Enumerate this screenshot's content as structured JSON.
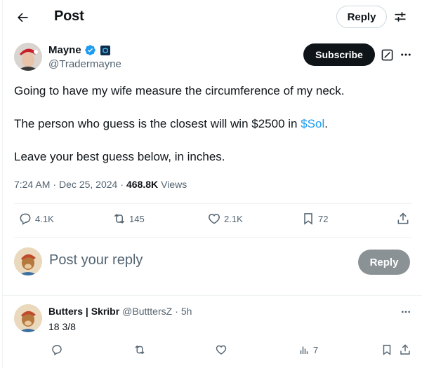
{
  "header": {
    "title": "Post",
    "reply_label": "Reply",
    "back_icon": "arrow-left-icon",
    "filter_icon": "sliders-icon"
  },
  "author": {
    "name": "Mayne",
    "handle": "@Tradermayne",
    "verified": true,
    "subscribe_label": "Subscribe"
  },
  "tweet": {
    "line1": "Going to have my wife measure the circumference of my neck.",
    "line2_before": "The person who guess is the closest will win $2500 in ",
    "line2_cashtag": "$Sol",
    "line2_after": ".",
    "line3": "Leave your best guess below, in inches.",
    "time": "7:24 AM",
    "sep1": "·",
    "date": "Dec 25, 2024",
    "sep2": "·",
    "views_count": "468.8K",
    "views_label": "Views"
  },
  "stats": {
    "replies": "4.1K",
    "reposts": "145",
    "likes": "2.1K",
    "bookmarks": "72"
  },
  "compose": {
    "placeholder": "Post your reply",
    "reply_label": "Reply"
  },
  "reply": {
    "name": "Butters | Skribr",
    "handle": "@ButttersZ",
    "dot": "·",
    "time": "5h",
    "text": "18 3/8",
    "views": "7"
  },
  "colors": {
    "accent": "#1d9bf0",
    "text": "#0f1419",
    "secondary": "#536471",
    "reply_disabled": "#8b9296"
  }
}
